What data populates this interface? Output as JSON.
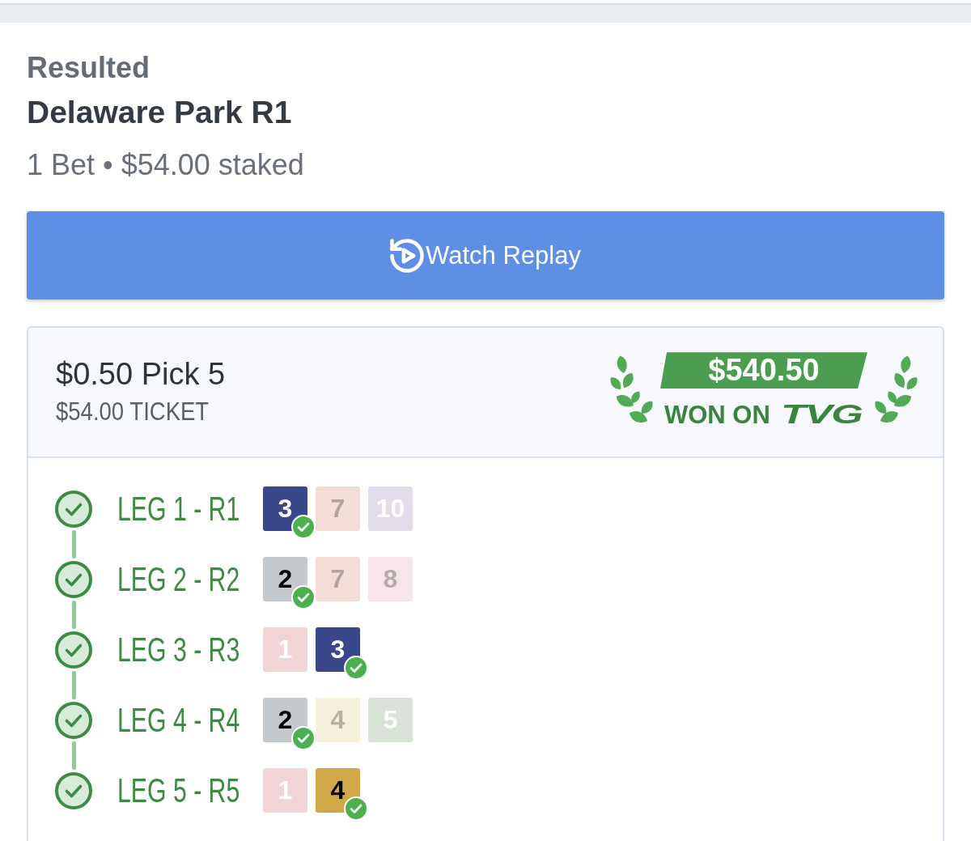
{
  "status": "Resulted",
  "title": "Delaware Park R1",
  "summary": "1 Bet • $54.00 staked",
  "replay_button": {
    "label": "Watch Replay"
  },
  "ticket": {
    "bet_type": "$0.50 Pick 5",
    "ticket_cost": "$54.00 TICKET",
    "winnings": {
      "amount": "$540.50",
      "label": "WON ON",
      "logo_text": "TVG"
    },
    "legs": [
      {
        "label": "LEG 1 - R1",
        "won": true,
        "runners": [
          {
            "number": "3",
            "color": "#39488a",
            "winner": true
          },
          {
            "number": "7",
            "color": "#f4ddd4",
            "winner": false
          },
          {
            "number": "10",
            "color": "#e3dcec",
            "winner": false
          }
        ]
      },
      {
        "label": "LEG 2 - R2",
        "won": true,
        "runners": [
          {
            "number": "2",
            "color": "#c3c9cc",
            "winner": true
          },
          {
            "number": "7",
            "color": "#f4ddd4",
            "winner": false
          },
          {
            "number": "8",
            "color": "#f6e6e9",
            "winner": false
          }
        ]
      },
      {
        "label": "LEG 3 - R3",
        "won": true,
        "runners": [
          {
            "number": "1",
            "color": "#f1d4d6",
            "winner": false
          },
          {
            "number": "3",
            "color": "#39488a",
            "winner": true
          }
        ]
      },
      {
        "label": "LEG 4 - R4",
        "won": true,
        "runners": [
          {
            "number": "2",
            "color": "#c3c9cc",
            "winner": true
          },
          {
            "number": "4",
            "color": "#f5efdc",
            "winner": false
          },
          {
            "number": "5",
            "color": "#d6e3d5",
            "winner": false
          }
        ]
      },
      {
        "label": "LEG 5 - R5",
        "won": true,
        "runners": [
          {
            "number": "1",
            "color": "#f1d4d6",
            "winner": false
          },
          {
            "number": "4",
            "color": "#d1a84a",
            "winner": true
          }
        ]
      }
    ]
  }
}
